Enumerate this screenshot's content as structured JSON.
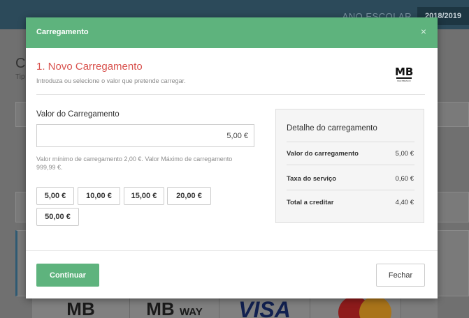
{
  "background": {
    "school_year_label": "ANO ESCOLAR",
    "school_year_value": "2018/2019",
    "page_title_partial": "C",
    "page_subtitle_partial": "Tip",
    "payment_methods": [
      "MB",
      "MB",
      "WAY",
      "VISA",
      "mastercard-logo"
    ]
  },
  "modal": {
    "title": "Carregamento",
    "close_icon": "×",
    "step_title": "1. Novo Carregamento",
    "step_subtitle": "Introduza ou selecione o valor que pretende carregar.",
    "logo": {
      "text": "MB",
      "small": "MULTIBANCO"
    },
    "amount_label": "Valor do Carregamento",
    "amount_value": "5,00 €",
    "help_text": "Valor mínimo de carregamento 2,00 €. Valor Máximo de carregamento 999,99 €.",
    "quick_amounts": [
      "5,00 €",
      "10,00 €",
      "15,00 €",
      "20,00 €",
      "50,00 €"
    ],
    "detail": {
      "title": "Detalhe do carregamento",
      "rows": [
        {
          "label": "Valor do carregamento",
          "value": "5,00 €"
        },
        {
          "label": "Taxa do serviço",
          "value": "0,60 €"
        },
        {
          "label": "Total a creditar",
          "value": "4,40 €"
        }
      ]
    },
    "continue_label": "Continuar",
    "close_label": "Fechar"
  },
  "colors": {
    "accent": "#5eb37d",
    "step_title": "#d9534f",
    "header_bg": "#2c4a5a"
  }
}
